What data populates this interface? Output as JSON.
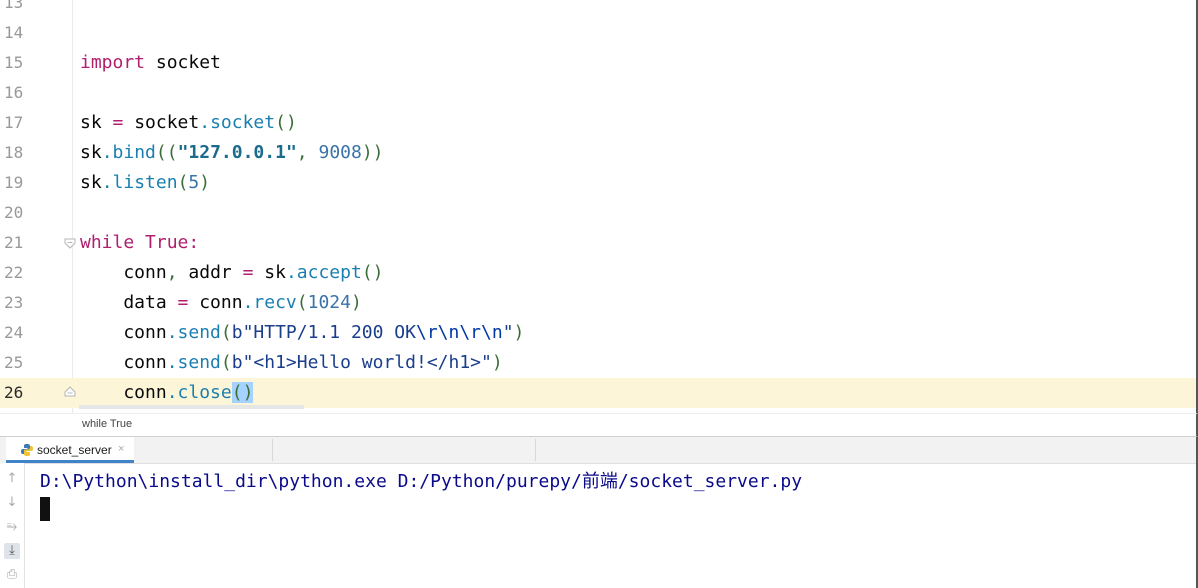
{
  "editor": {
    "lines": [
      {
        "num": "13"
      },
      {
        "num": "14"
      },
      {
        "num": "15",
        "t1": "import",
        "t2": " socket"
      },
      {
        "num": "16"
      },
      {
        "num": "17",
        "t1": "sk",
        "t2": " = ",
        "t3": "socket",
        "t4": ".",
        "t5": "socket",
        "t6": "()"
      },
      {
        "num": "18",
        "t1": "sk",
        "t2": ".",
        "t3": "bind",
        "t4": "((",
        "t5": "\"127.0.0.1\"",
        "t6": ", ",
        "t7": "9008",
        "t8": "))"
      },
      {
        "num": "19",
        "t1": "sk",
        "t2": ".",
        "t3": "listen",
        "t4": "(",
        "t5": "5",
        "t6": ")"
      },
      {
        "num": "20"
      },
      {
        "num": "21",
        "t1": "while",
        "t2": " ",
        "t3": "True",
        "t4": ":"
      },
      {
        "num": "22",
        "t1": "    conn",
        "t2": ", ",
        "t3": "addr",
        "t4": " = ",
        "t5": "sk",
        "t6": ".",
        "t7": "accept",
        "t8": "()"
      },
      {
        "num": "23",
        "t1": "    data",
        "t2": " = ",
        "t3": "conn",
        "t4": ".",
        "t5": "recv",
        "t6": "(",
        "t7": "1024",
        "t8": ")"
      },
      {
        "num": "24",
        "t1": "    conn",
        "t2": ".",
        "t3": "send",
        "t4": "(",
        "t5": "b\"HTTP/1.1 200 OK",
        "t6": "\\r\\n\\r\\n",
        "t7": "\"",
        "t8": ")"
      },
      {
        "num": "25",
        "t1": "    conn",
        "t2": ".",
        "t3": "send",
        "t4": "(",
        "t5": "b\"<h1>Hello world!</h1>\"",
        "t6": ")"
      },
      {
        "num": "26",
        "t1": "    conn",
        "t2": ".",
        "t3": "close",
        "t4": "()"
      }
    ],
    "breadcrumb": "while True"
  },
  "run_panel": {
    "tab_label": "socket_server",
    "tab_close": "×",
    "console_line": "D:\\Python\\install_dir\\python.exe D:/Python/purepy/前端/socket_server.py"
  },
  "tools": [
    {
      "name": "up-arrow-icon",
      "glyph": "↑"
    },
    {
      "name": "down-arrow-icon",
      "glyph": "↓"
    },
    {
      "name": "soft-wrap-icon",
      "glyph": "⥱"
    },
    {
      "name": "scroll-to-end-icon",
      "glyph": "⤓"
    },
    {
      "name": "print-icon",
      "glyph": "⎙"
    }
  ],
  "colors": {
    "keyword": "#a31e6c",
    "method": "#1a7fb0",
    "number": "#1750eb",
    "string": "#067d17",
    "current_line": "#fcf5d8",
    "console_text": "#0a0a8a"
  }
}
